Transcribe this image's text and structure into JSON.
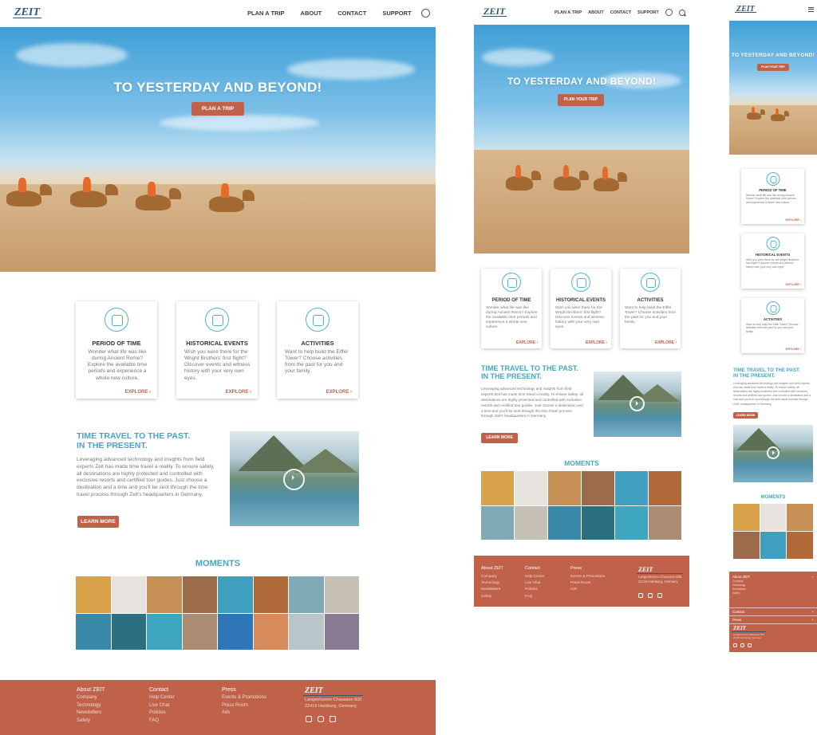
{
  "brand": {
    "logo": "ZEIT",
    "accent": "#c0624a",
    "teal": "#45a6c1"
  },
  "nav": {
    "plan": "PLAN A TRIP",
    "about": "ABOUT",
    "contact": "CONTACT",
    "support": "SUPPORT"
  },
  "hero": {
    "title": "TO YESTERDAY AND BEYOND!",
    "cta_desktop": "PLAN A TRIP",
    "cta_tablet": "PLAN YOUR TRIP",
    "cta_mobile": "PLAN YOUR TRIP"
  },
  "cards": [
    {
      "title": "PERIOD OF TIME",
      "desc": "Wonder what life was like during Ancient Rome? Explore the available time periods and experience a whole new culture.",
      "link": "EXPLORE ›",
      "icon": "alarm-clock-icon"
    },
    {
      "title": "HISTORICAL EVENTS",
      "desc": "Wish you were there for the Wright Brothers' first flight? Discover events and witness history with your very own eyes.",
      "link": "EXPLORE ›",
      "icon": "calendar-icon"
    },
    {
      "title": "ACTIVITIES",
      "desc": "Want to help build the Eiffel Tower? Choose activities from the past for you and your family.",
      "link": "EXPLORE ›",
      "icon": "diving-mask-icon"
    }
  ],
  "info": {
    "title_line1": "TIME TRAVEL TO THE PAST.",
    "title_line2": "IN THE PRESENT.",
    "body": "Leveraging advanced technology and insights from field experts Zeit has made time travel a reality. To ensure safety, all destinations are highly protected and controlled with exclusive resorts and certified tour guides. Just choose a destination and a time and you'll be sent through the time travel process through Zeit's headquarters in Germany.",
    "cta": "LEARN MORE"
  },
  "moments": {
    "title": "MOMENTS",
    "tiles": [
      "#d9a24a",
      "#e7e4df",
      "#c58f55",
      "#9b6b4b",
      "#3f9fbf",
      "#b06a3a",
      "#7fa9b5",
      "#c7c0b4",
      "#3a89a8",
      "#2b6f80",
      "#3fa6c0",
      "#a98c73",
      "#2f76b8",
      "#d78a5a",
      "#b9c6c9",
      "#8a7a93"
    ]
  },
  "footer": {
    "col1": {
      "head": "About ZEIT",
      "items": [
        "Company",
        "Technology",
        "Newsletters",
        "Safety"
      ]
    },
    "col2": {
      "head": "Contact",
      "items": [
        "Help Center",
        "Live Chat",
        "Policies",
        "FAQ"
      ]
    },
    "col3": {
      "head": "Press",
      "items": [
        "Events & Promotions",
        "Press Room",
        "Ads"
      ]
    },
    "address1": "Langenhorner Chaussee 600",
    "address2": "22419 Hamburg, Germany",
    "mobile_address1": "Langenhorner Chaussee 600",
    "mobile_address2": "22419 Hamburg, Germany"
  },
  "mobile_acc": {
    "about": "About ZEIT",
    "contact": "Contact",
    "press": "Press",
    "minus": "–",
    "plus": "+"
  }
}
